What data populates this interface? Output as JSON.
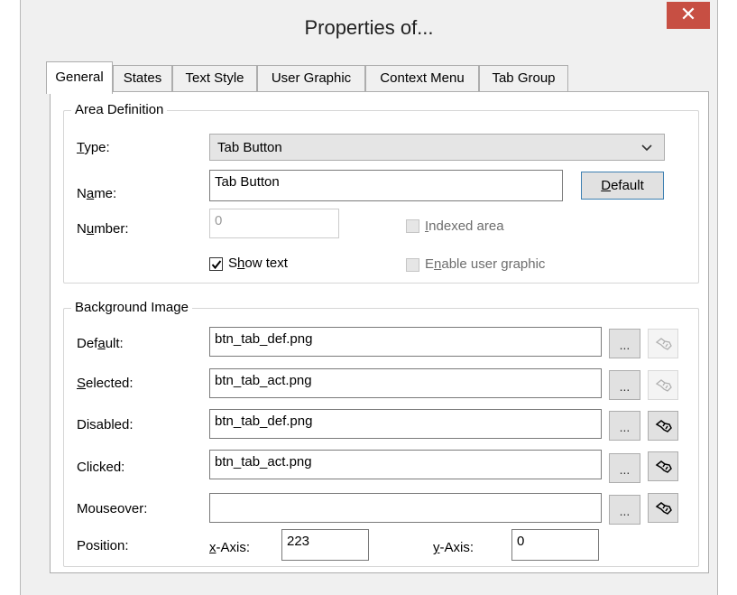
{
  "window": {
    "title": "Properties of...",
    "close_glyph": "✕"
  },
  "tabs": [
    {
      "label": "General",
      "active": true
    },
    {
      "label": "States"
    },
    {
      "label": "Text Style"
    },
    {
      "label": "User Graphic"
    },
    {
      "label": "Context Menu"
    },
    {
      "label": "Tab Group"
    }
  ],
  "area_definition": {
    "group_label": "Area Definition",
    "type_label_u": "T",
    "type_label_rest": "ype:",
    "type_value": "Tab Button",
    "name_label_pre": "N",
    "name_label_u": "a",
    "name_label_rest": "me:",
    "name_value": "Tab Button",
    "default_button_u": "D",
    "default_button_rest": "efault",
    "number_label_pre": "N",
    "number_label_u": "u",
    "number_label_rest": "mber:",
    "number_value": "0",
    "indexed_area_u": "I",
    "indexed_area_rest": "ndexed area",
    "show_text_pre": "S",
    "show_text_u": "h",
    "show_text_rest": "ow text",
    "show_text_checked": true,
    "enable_user_graphic_pre": "E",
    "enable_user_graphic_u": "n",
    "enable_user_graphic_rest": "able user graphic"
  },
  "background_image": {
    "group_label": "Background Image",
    "rows": [
      {
        "label_pre": "Def",
        "label_u": "a",
        "label_rest": "ult:",
        "value": "btn_tab_def.png",
        "browse": "...",
        "icon_enabled": false
      },
      {
        "label_pre": "",
        "label_u": "S",
        "label_rest": "elected:",
        "value": "btn_tab_act.png",
        "browse": "...",
        "icon_enabled": false
      },
      {
        "label_pre": "",
        "label_u": "",
        "label_rest": "Disabled:",
        "value": "btn_tab_def.png",
        "browse": "...",
        "icon_enabled": true
      },
      {
        "label_pre": "",
        "label_u": "",
        "label_rest": "Clicked:",
        "value": "btn_tab_act.png",
        "browse": "...",
        "icon_enabled": true
      },
      {
        "label_pre": "",
        "label_u": "",
        "label_rest": "Mouseover:",
        "value": "",
        "browse": "...",
        "icon_enabled": true
      }
    ],
    "position_label": "Position:",
    "x_axis_u": "x",
    "x_axis_rest": "-Axis:",
    "x_value": "223",
    "y_axis_u": "y",
    "y_axis_rest": "-Axis:",
    "y_value": "0"
  },
  "colors": {
    "close_button": "#c74f43",
    "window_bg": "#f0f0f0",
    "default_button_border": "#3c7fb1"
  }
}
